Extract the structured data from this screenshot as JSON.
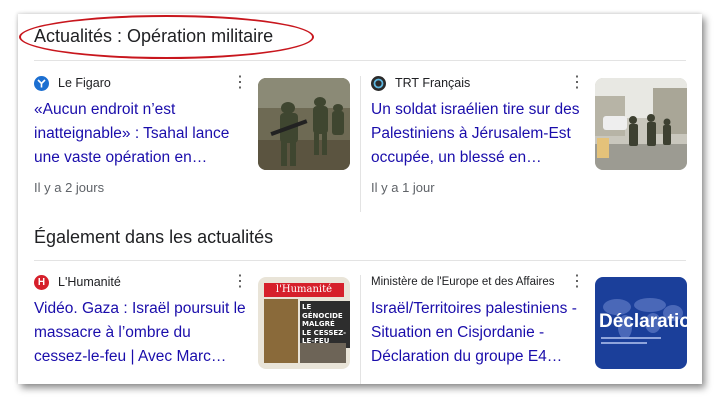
{
  "sections": {
    "top_title": "Actualités : Opération militaire",
    "also_title": "Également dans les actualités"
  },
  "cards": [
    {
      "source": "Le Figaro",
      "favicon_color": "#1c6fd1",
      "headline": "«Aucun endroit n’est inatteignable» : Tsahal lance une vaste opération en…",
      "time": "Il y a 2 jours",
      "thumb_icon": "soldiers-photo"
    },
    {
      "source": "TRT Français",
      "favicon_color": "#2b2b2b",
      "headline": "Un soldat israélien tire sur des Palestiniens à Jérusalem-Est occupée, un blessé en…",
      "time": "Il y a 1 jour",
      "thumb_icon": "street-soldiers-photo"
    },
    {
      "source": "L'Humanité",
      "favicon_color": "#d6202b",
      "favicon_letter": "H",
      "headline": "Vidéo. Gaza : Israël poursuit le massacre à l’ombre du cessez-le-feu | Avec Marc…",
      "thumb_icon": "newspaper-cover",
      "cover": {
        "masthead": "l'Humanité",
        "lines": [
          "LE GÉNOCIDE",
          "MALGRÉ",
          "LE CESSEZ-",
          "LE-FEU"
        ]
      }
    },
    {
      "source": "Ministère de l'Europe et des Affaires",
      "headline": "Israël/Territoires palestiniens - Situation en Cisjordanie - Déclaration du groupe E4…",
      "thumb_icon": "declaration-banner",
      "banner_text": "Déclaration"
    }
  ],
  "colors": {
    "accent_ellipse": "#c8161d",
    "link": "#1a0dab",
    "declaration_bg": "#1b3f9a"
  }
}
